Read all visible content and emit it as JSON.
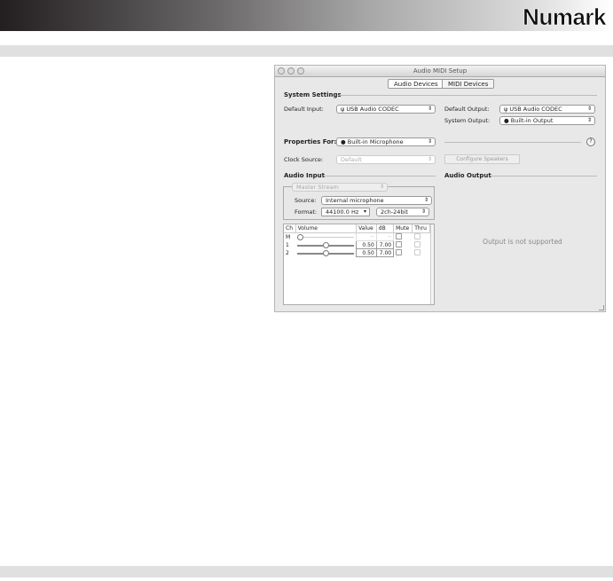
{
  "brand": "Numark",
  "window": {
    "title": "Audio MIDI Setup",
    "tabs": [
      {
        "label": "Audio Devices",
        "active": true
      },
      {
        "label": "MIDI Devices",
        "active": false
      }
    ],
    "system_settings": {
      "heading": "System Settings",
      "default_input_label": "Default Input:",
      "default_input": "USB Audio CODEC",
      "default_output_label": "Default Output:",
      "default_output": "USB Audio CODEC",
      "system_output_label": "System Output:",
      "system_output": "Built-in Output"
    },
    "properties_for_label": "Properties For:",
    "properties_for": "Built-in Microphone",
    "help": "?",
    "clock_source_label": "Clock Source:",
    "clock_source": "Default",
    "configure_speakers": "Configure Speakers",
    "audio_input": {
      "heading": "Audio Input",
      "stream": "Master Stream",
      "source_label": "Source:",
      "source": "Internal microphone",
      "format_label": "Format:",
      "format_rate": "44100.0 Hz",
      "format_bits": "2ch-24bit",
      "columns": [
        "Ch",
        "Volume",
        "Value",
        "dB",
        "Mute",
        "Thru"
      ],
      "rows": [
        {
          "ch": "M",
          "volume": 0,
          "value": "--",
          "db": "--"
        },
        {
          "ch": "1",
          "volume": 0.5,
          "value": "0.50",
          "db": "7.00"
        },
        {
          "ch": "2",
          "volume": 0.5,
          "value": "0.50",
          "db": "7.00"
        }
      ]
    },
    "audio_output": {
      "heading": "Audio Output",
      "message": "Output is not supported"
    }
  }
}
